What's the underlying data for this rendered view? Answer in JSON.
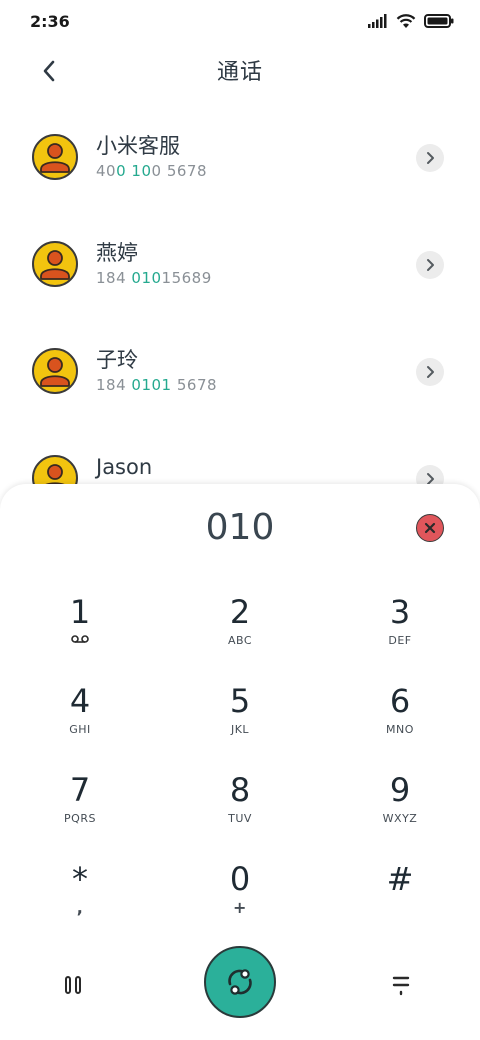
{
  "status": {
    "time": "2:36"
  },
  "header": {
    "title": "通话"
  },
  "contacts": [
    {
      "name": "小米客服",
      "number_parts": [
        [
          "40",
          false
        ],
        [
          "0",
          true
        ],
        [
          " ",
          false
        ],
        [
          "10",
          true
        ],
        [
          "0 5678",
          false
        ]
      ]
    },
    {
      "name": "燕婷",
      "number_parts": [
        [
          "184 ",
          false
        ],
        [
          "010",
          true
        ],
        [
          "15689",
          false
        ]
      ]
    },
    {
      "name": "子玲",
      "number_parts": [
        [
          "184 ",
          false
        ],
        [
          "0101",
          true
        ],
        [
          " 5678",
          false
        ]
      ]
    },
    {
      "name": "Jason",
      "number_parts": []
    }
  ],
  "dialer": {
    "input": "010",
    "keys": [
      {
        "digit": "1",
        "letters": "",
        "voicemail": true
      },
      {
        "digit": "2",
        "letters": "ABC"
      },
      {
        "digit": "3",
        "letters": "DEF"
      },
      {
        "digit": "4",
        "letters": "GHI"
      },
      {
        "digit": "5",
        "letters": "JKL"
      },
      {
        "digit": "6",
        "letters": "MNO"
      },
      {
        "digit": "7",
        "letters": "PQRS"
      },
      {
        "digit": "8",
        "letters": "TUV"
      },
      {
        "digit": "9",
        "letters": "WXYZ"
      },
      {
        "digit": "*",
        "letters": ","
      },
      {
        "digit": "0",
        "letters": "+"
      },
      {
        "digit": "#",
        "letters": ""
      }
    ]
  },
  "colors": {
    "accent": "#2bb09a",
    "highlight": "#25a98f",
    "avatar": "#f2c40f",
    "clear": "#e0565b"
  },
  "icons": {
    "back": "chevron-left-icon",
    "contact_avatar": "person-icon",
    "detail": "chevron-right-icon",
    "clear": "close-icon",
    "pause": "pause-icon",
    "call": "call-icon",
    "menu": "menu-icon",
    "signal": "signal-icon",
    "wifi": "wifi-icon",
    "battery": "battery-icon"
  }
}
